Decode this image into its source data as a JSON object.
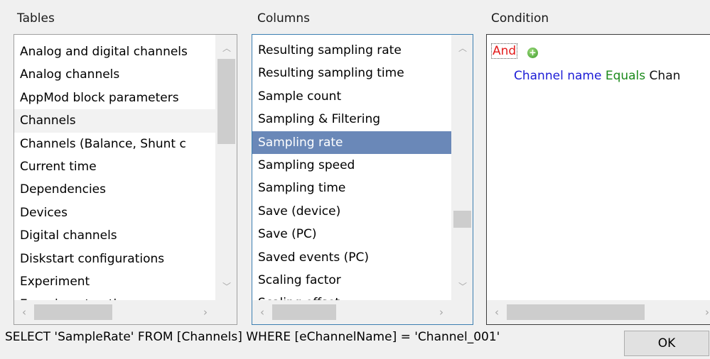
{
  "headers": {
    "tables": "Tables",
    "columns": "Columns",
    "condition": "Condition"
  },
  "tables": {
    "items": [
      "Analog and digital channels",
      "Analog channels",
      "AppMod block parameters",
      "Channels",
      "Channels (Balance, Shunt c",
      "Current time",
      "Dependencies",
      "Devices",
      "Digital channels",
      "Diskstart configurations",
      "Experiment",
      "Experiment options"
    ],
    "hovered": "Channels"
  },
  "columns": {
    "items": [
      "Resulting sampling rate",
      "Resulting sampling time",
      "Sample count",
      "Sampling & Filtering",
      "Sampling rate",
      "Sampling speed",
      "Sampling time",
      "Save (device)",
      "Save (PC)",
      "Saved events (PC)",
      "Scaling factor",
      "Scaling offset"
    ],
    "selected": "Sampling rate"
  },
  "condition": {
    "operator": "And",
    "field": "Channel name",
    "comparison": "Equals",
    "value": "Chan"
  },
  "scroll_glyphs": {
    "up": "︿",
    "down": "﹀",
    "left": "‹",
    "right": "›",
    "plus": "+"
  },
  "sql": "SELECT 'SampleRate' FROM [Channels] WHERE [eChannelName] = 'Channel_001'",
  "ok_label": "OK",
  "colors": {
    "selection": "#6a88b8",
    "operator_red": "#e31b1b",
    "field_blue": "#1c1cd6",
    "comparison_green": "#1b8a1b"
  }
}
